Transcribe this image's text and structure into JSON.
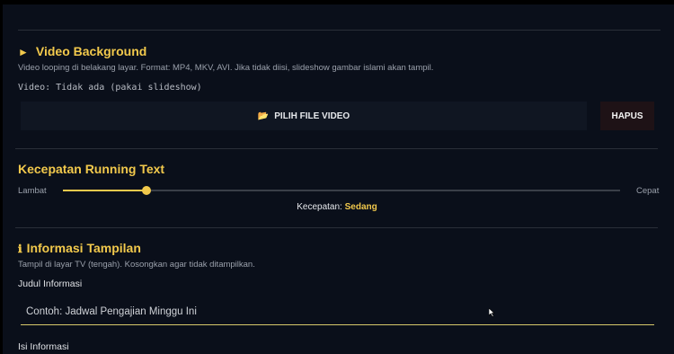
{
  "video": {
    "title": "Video Background",
    "title_icon": "play-triangle-icon",
    "description": "Video looping di belakang layar. Format: MP4, MKV, AVI. Jika tidak diisi, slideshow gambar islami akan tampil.",
    "status": "Video: Tidak ada (pakai slideshow)",
    "pick_label": "PILIH FILE VIDEO",
    "pick_icon": "folder-open-icon",
    "delete_label": "HAPUS"
  },
  "speed": {
    "title": "Kecepatan Running Text",
    "min_label": "Lambat",
    "max_label": "Cepat",
    "level_fraction": 0.15,
    "readout_label": "Kecepatan:",
    "readout_value": "Sedang"
  },
  "info": {
    "title": "Informasi Tampilan",
    "title_icon": "info-icon",
    "description": "Tampil di layar TV (tengah). Kosongkan agar tidak ditampilkan.",
    "title_field_label": "Judul Informasi",
    "title_field_placeholder": "Contoh: Jadwal Pengajian Minggu Ini",
    "title_field_value": "",
    "content_field_label": "Isi Informasi"
  },
  "colors": {
    "accent": "#f2c94c",
    "background": "#0a0f1a",
    "danger_button": "#1e1216"
  }
}
